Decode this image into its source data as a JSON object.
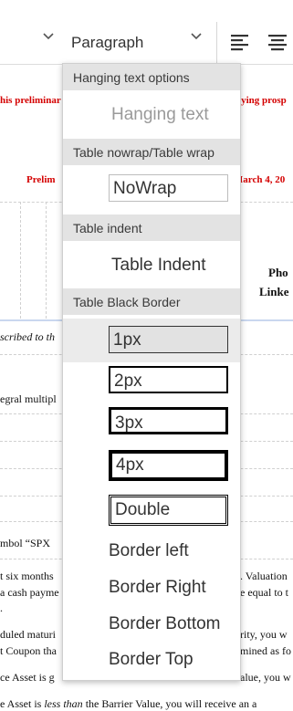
{
  "toolbar": {
    "block_format": "Paragraph"
  },
  "document": {
    "red_line_1_left": "his preliminar",
    "red_line_1_right": "nying prosp",
    "red_line_2_left": "Prelim",
    "red_line_2_right": "Iarch 4, 20",
    "header_cell_right_1": "Pho",
    "header_cell_right_2": "Linke",
    "italic_line": "scribed to th",
    "line_integral": "egral multipl",
    "line_symbol": "mbol “SPX",
    "line_six_months": "t six months",
    "line_valuation": ". Valuation",
    "line_cash": "a cash payme",
    "line_equal": "e equal to t",
    "line_dot": ".",
    "line_duled": "duled maturi",
    "line_rity": "rity, you w",
    "line_coupon": "t Coupon tha",
    "line_mined": "mined as fo",
    "line_ce_asset": "ce Asset is g",
    "line_alue": "alue, you w",
    "line_bottom_a": "e Asset is ",
    "line_bottom_italic": "less than",
    "line_bottom_b": " the Barrier Value, you will receive an a"
  },
  "menu": {
    "sections": [
      {
        "header": "Hanging text options",
        "items": [
          "Hanging text"
        ]
      },
      {
        "header": "Table nowrap/Table wrap",
        "items": [
          "NoWrap"
        ]
      },
      {
        "header": "Table indent",
        "items": [
          "Table Indent"
        ]
      },
      {
        "header": "Table Black Border",
        "items": [
          "1px",
          "2px",
          "3px",
          "4px",
          "Double",
          "Border left",
          "Border Right",
          "Border Bottom",
          "Border Top"
        ]
      }
    ],
    "selected_item": "1px"
  },
  "colors": {
    "red_text": "#d40000",
    "header_bg": "#e3e3e3",
    "selected_bg": "#ebebeb"
  }
}
